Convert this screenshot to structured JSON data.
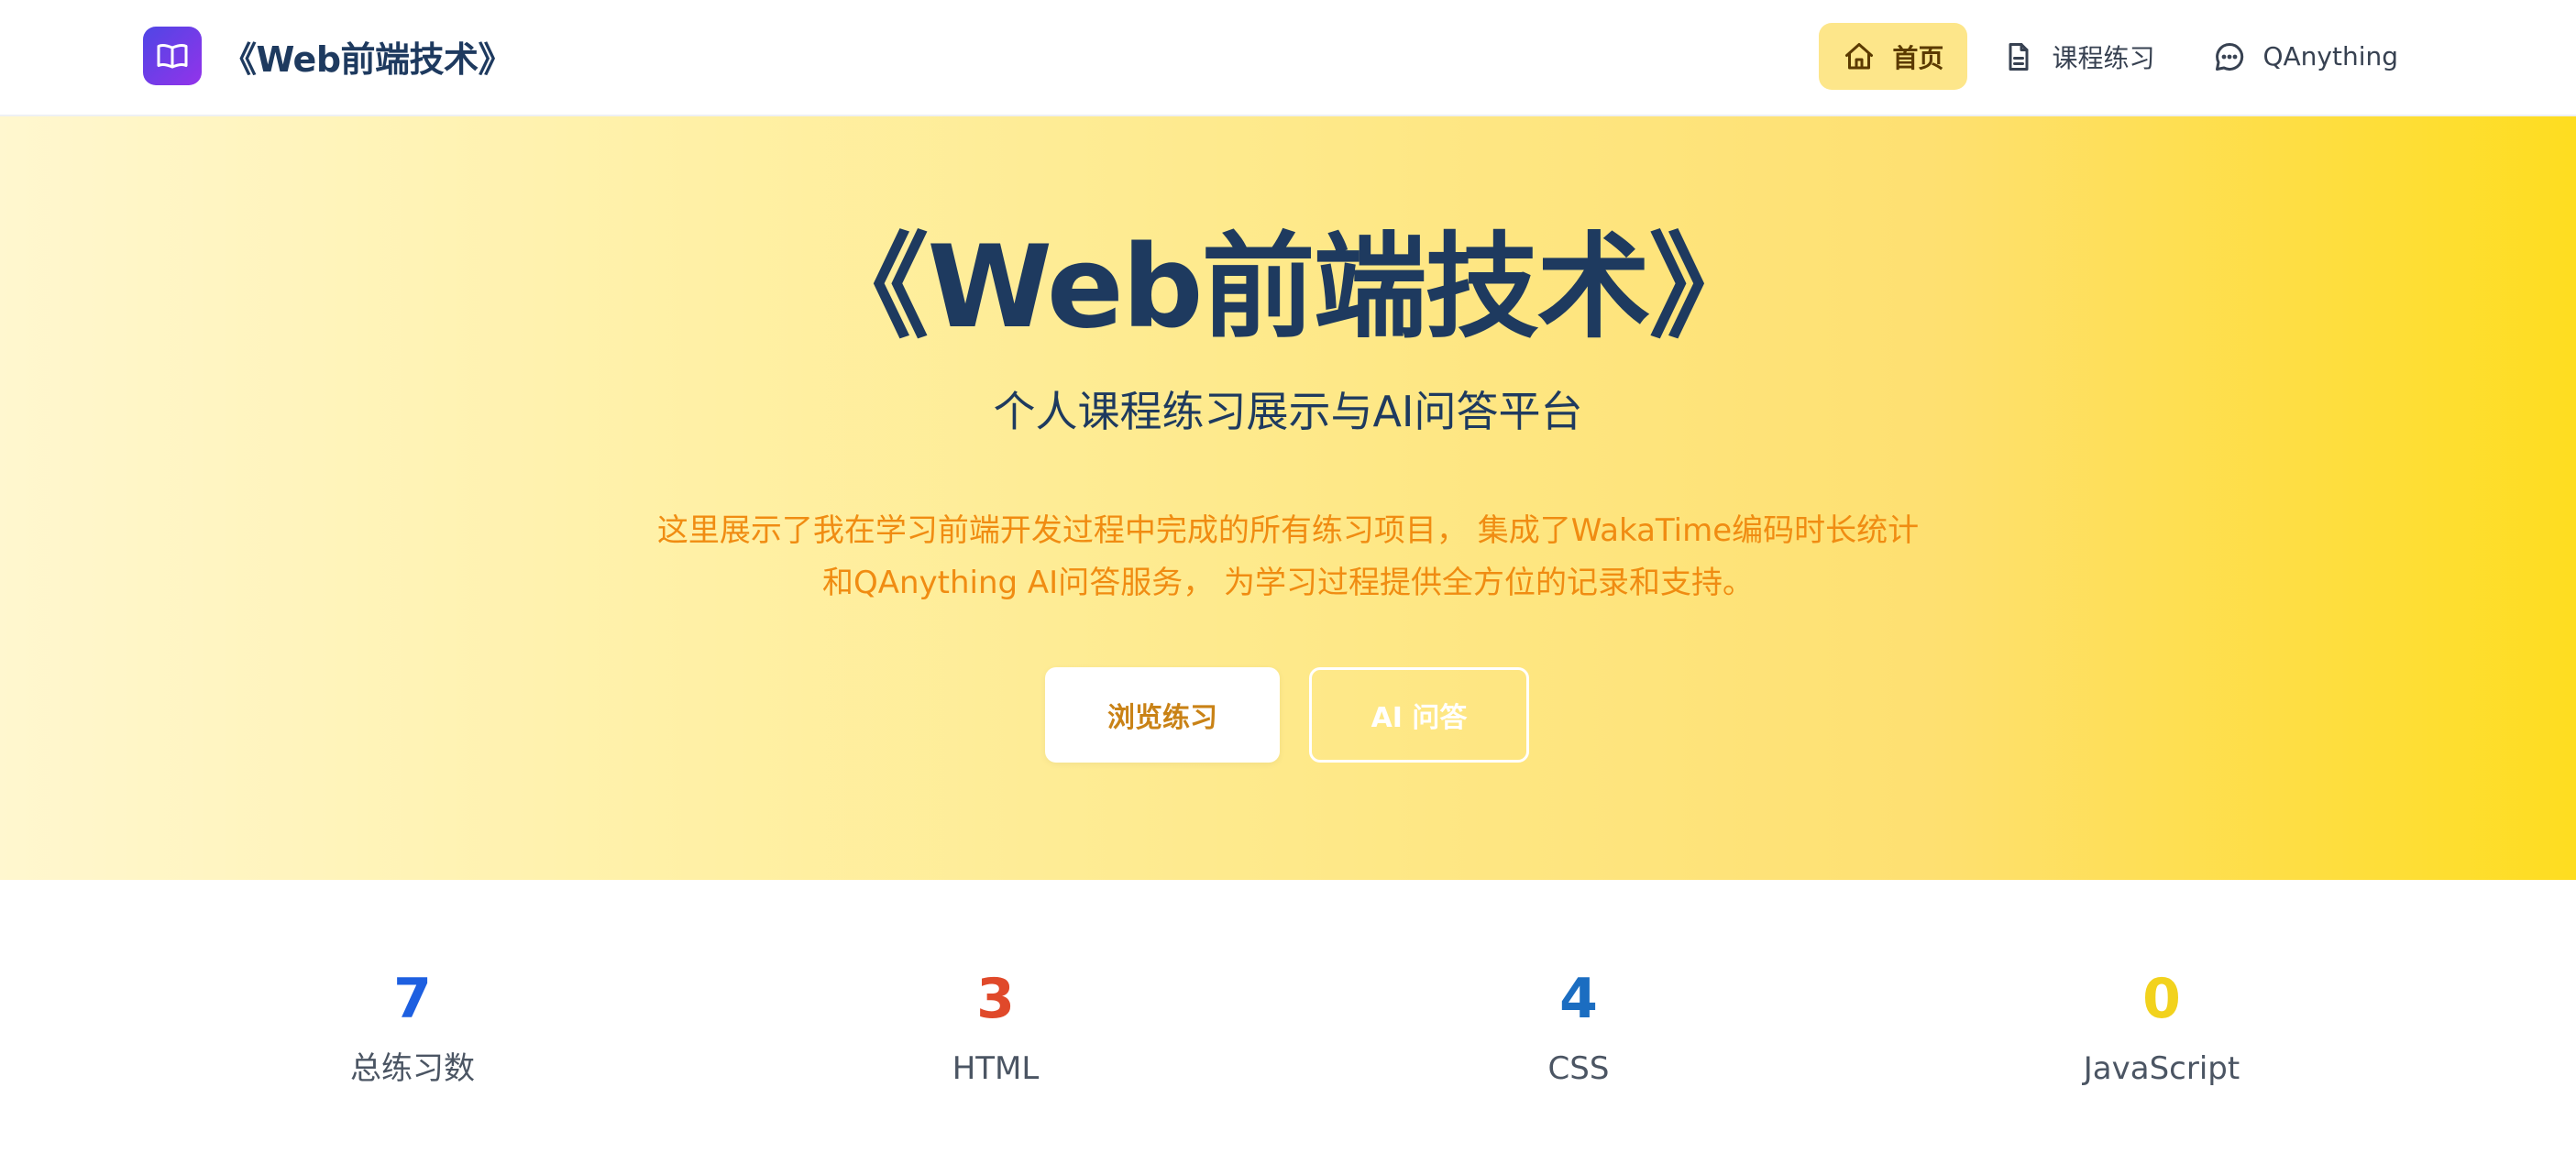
{
  "header": {
    "brand_title": "《Web前端技术》",
    "nav": [
      {
        "label": "首页",
        "icon": "home-icon",
        "active": true
      },
      {
        "label": "课程练习",
        "icon": "document-icon",
        "active": false
      },
      {
        "label": "QAnything",
        "icon": "chat-icon",
        "active": false
      }
    ]
  },
  "hero": {
    "title": "《Web前端技术》",
    "subtitle": "个人课程练习展示与AI问答平台",
    "description": "这里展示了我在学习前端开发过程中完成的所有练习项目， 集成了WakaTime编码时长统计和QAnything AI问答服务， 为学习过程提供全方位的记录和支持。",
    "primary_button": "浏览练习",
    "secondary_button": "AI 问答"
  },
  "stats": [
    {
      "value": "7",
      "label": "总练习数",
      "color": "#1d5fe0"
    },
    {
      "value": "3",
      "label": "HTML",
      "color": "#e0492a"
    },
    {
      "value": "4",
      "label": "CSS",
      "color": "#1b6dc1"
    },
    {
      "value": "0",
      "label": "JavaScript",
      "color": "#f2d21d"
    }
  ],
  "colors": {
    "brand_text": "#1e3a5f",
    "accent_orange": "#f08c12",
    "nav_active_bg": "#fde68a"
  }
}
